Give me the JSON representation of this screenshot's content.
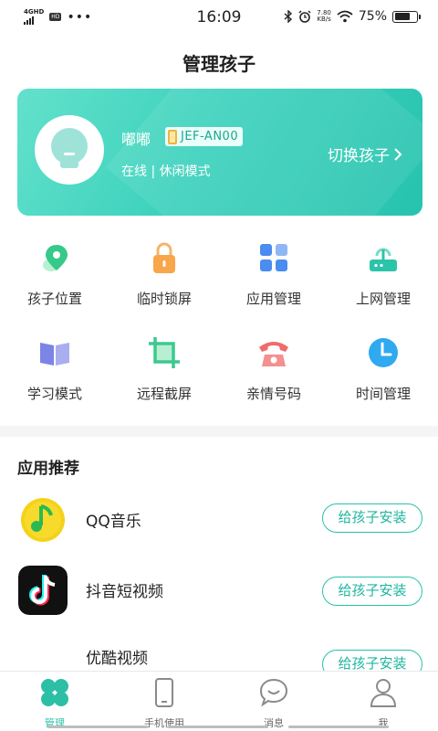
{
  "status_bar": {
    "network": "4GHD",
    "badge": "HD",
    "dots": "•••",
    "time": "16:09",
    "speed_value": "7.80",
    "speed_unit": "KB/s",
    "battery": "75%",
    "battery_level": 0.75
  },
  "page": {
    "title": "管理孩子"
  },
  "child_card": {
    "name": "嘟嘟",
    "device": "JEF-AN00",
    "status": "在线 | 休闲模式",
    "switch_label": "切换孩子",
    "switch_icon": "chevron-right-icon"
  },
  "features": [
    {
      "label": "孩子位置",
      "icon": "location-pin-icon",
      "color": "#3dcf8e"
    },
    {
      "label": "临时锁屏",
      "icon": "lock-icon",
      "color": "#f7a64a"
    },
    {
      "label": "应用管理",
      "icon": "apps-grid-icon",
      "color": "#4a8cf0"
    },
    {
      "label": "上网管理",
      "icon": "router-icon",
      "color": "#2bc4a9"
    },
    {
      "label": "学习模式",
      "icon": "book-icon",
      "color": "#7c84e6"
    },
    {
      "label": "远程截屏",
      "icon": "crop-icon",
      "color": "#3bc98f"
    },
    {
      "label": "亲情号码",
      "icon": "telephone-icon",
      "color": "#f06b6b"
    },
    {
      "label": "时间管理",
      "icon": "clock-icon",
      "color": "#2fa9f0"
    }
  ],
  "recommendations": {
    "title": "应用推荐",
    "apps": [
      {
        "name": "QQ音乐",
        "button": "给孩子安装",
        "icon": "qq-music-icon"
      },
      {
        "name": "抖音短视频",
        "button": "给孩子安装",
        "icon": "douyin-icon"
      },
      {
        "name": "优酷视频",
        "button": "给孩子安装",
        "icon": "youku-icon"
      }
    ]
  },
  "tabbar": {
    "tabs": [
      {
        "label": "管理",
        "icon": "clover-icon",
        "active": true
      },
      {
        "label": "手机使用",
        "icon": "phone-icon",
        "active": false
      },
      {
        "label": "消息",
        "icon": "chat-bubble-icon",
        "active": false
      },
      {
        "label": "我",
        "icon": "person-icon",
        "active": false
      }
    ]
  },
  "colors": {
    "accent": "#2bbfa6",
    "card_gradient_start": "#63e1cc",
    "card_gradient_end": "#27c3ae"
  }
}
